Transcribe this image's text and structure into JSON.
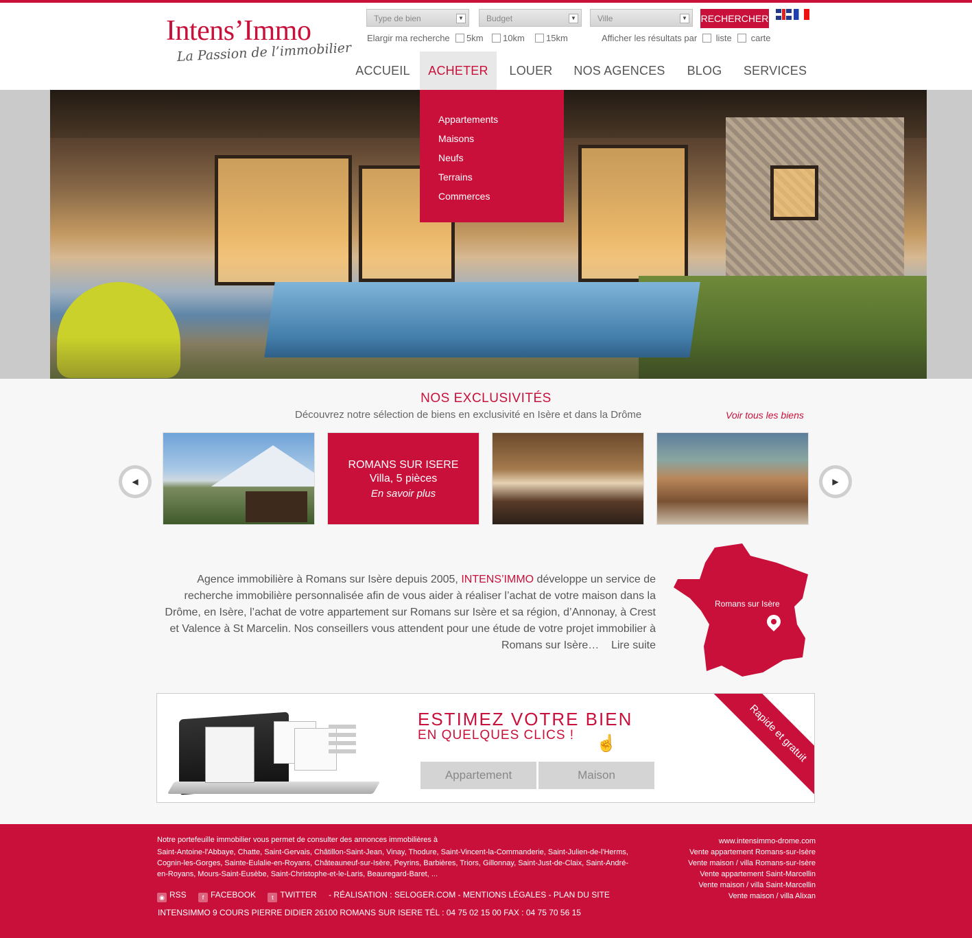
{
  "brand": {
    "name": "Intens’Immo",
    "tagline": "La Passion de l’immobilier",
    "accent_color": "#c8103a"
  },
  "search": {
    "type_label": "Type de bien",
    "budget_label": "Budget",
    "city_label": "Ville",
    "button_label": "RECHERCHER",
    "widen_label": "Elargir ma recherche",
    "radius_options": [
      "5km",
      "10km",
      "15km"
    ],
    "display_label": "Afficher les résultats par",
    "display_options": [
      "liste",
      "carte"
    ]
  },
  "languages": [
    {
      "code": "en",
      "icon": "uk-flag-icon"
    },
    {
      "code": "fr",
      "icon": "fr-flag-icon"
    }
  ],
  "nav": {
    "items": [
      "ACCUEIL",
      "ACHETER",
      "LOUER",
      "NOS AGENCES",
      "BLOG",
      "SERVICES"
    ],
    "active_index": 1
  },
  "dropdown": {
    "items": [
      "Appartements",
      "Maisons",
      "Neufs",
      "Terrains",
      "Commerces"
    ]
  },
  "exclusives": {
    "title": "NOS EXCLUSIVITÉS",
    "subtitle": "Découvrez notre sélection de biens en exclusivité en Isère et dans la Drôme",
    "view_all": "Voir tous les biens",
    "featured": {
      "city": "ROMANS SUR ISERE",
      "type": "Villa, 5 pièces",
      "more": "En savoir plus"
    }
  },
  "about": {
    "text_before": "Agence immobilière à Romans sur Isère depuis 2005, ",
    "brand": "INTENS’IMMO",
    "text_after": " développe un service de recherche immobilière personnalisée afin de vous aider à réaliser l’achat de votre maison dans la Drôme, en Isère, l’achat de votre appartement sur Romans sur Isère et sa région, d’Annonay, à Crest et Valence à St Marcelin. Nos conseillers vous attendent pour une étude de votre projet immobilier à Romans sur Isère…",
    "read_more": "Lire suite",
    "map_label": "Romans sur Isère"
  },
  "estimate": {
    "title": "ESTIMEZ VOTRE BIEN",
    "subtitle": "EN QUELQUES CLICS !",
    "button_apartment": "Appartement",
    "button_house": "Maison",
    "ribbon": "Rapide et gratuit"
  },
  "footer": {
    "intro": "Notre portefeuille immobilier vous permet de consulter des annonces immobilières à",
    "towns": "Saint-Antoine-l'Abbaye, Chatte, Saint-Gervais, Châtillon-Saint-Jean, Vinay, Thodure, Saint-Vincent-la-Commanderie, Saint-Julien-de-l'Herms, Cognin-les-Gorges, Sainte-Eulalie-en-Royans, Châteauneuf-sur-Isère, Peyrins, Barbières, Triors, Gillonnay, Saint-Just-de-Claix, Saint-André-en-Royans, Mours-Saint-Eusèbe, Saint-Christophe-et-le-Laris, Beauregard-Baret, ...",
    "links_right": [
      "www.intensimmo-drome.com",
      "Vente appartement Romans-sur-Isère",
      "Vente maison / villa Romans-sur-Isère",
      "Vente appartement Saint-Marcellin",
      "Vente maison / villa Saint-Marcellin",
      "Vente maison / villa Alixan"
    ],
    "rss": "RSS",
    "facebook": "FACEBOOK",
    "twitter": "TWITTER",
    "legal": "-    RÉALISATION : SELOGER.COM - MENTIONS LÉGALES - PLAN DU SITE",
    "address": "INTENSIMMO 9 COURS PIERRE DIDIER 26100 ROMANS SUR ISERE TÉL : 04 75 02 15 00 FAX : 04 75 70 56 15"
  }
}
